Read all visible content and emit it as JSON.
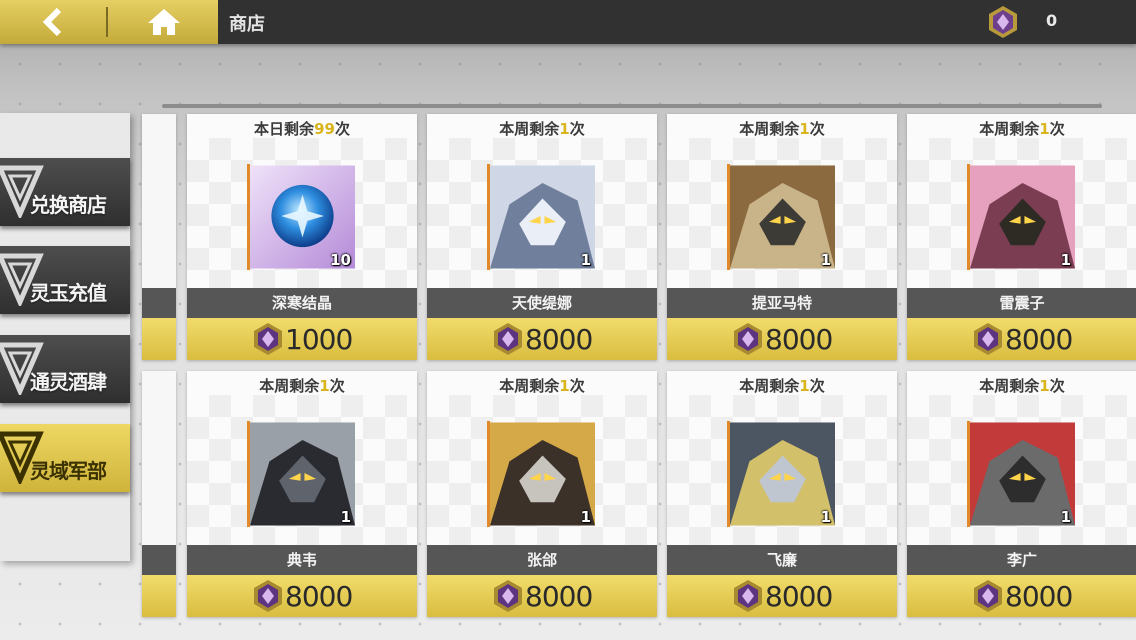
{
  "header": {
    "title": "商店",
    "currency_amount": "0",
    "back_icon": "back-arrow-icon",
    "home_icon": "home-icon",
    "currency_icon": "purple-gem-icon"
  },
  "colors": {
    "accent_gold": "#e3cb5a",
    "topbar": "#313131",
    "limit_highlight": "#d9b51b",
    "name_bar": "#565656"
  },
  "sidebar": {
    "tabs": [
      {
        "label": "兑换商店",
        "active": false
      },
      {
        "label": "灵玉充值",
        "active": false
      },
      {
        "label": "通灵酒肆",
        "active": false
      },
      {
        "label": "灵域军部",
        "active": true
      }
    ]
  },
  "shop": {
    "items": [
      {
        "limit_prefix": "本日剩余",
        "limit_num": "99",
        "limit_suffix": "次",
        "name": "深寒结晶",
        "qty": "10",
        "price": "1000",
        "icon": "ice-crystal-icon"
      },
      {
        "limit_prefix": "本周剩余",
        "limit_num": "1",
        "limit_suffix": "次",
        "name": "天使缇娜",
        "qty": "1",
        "price": "8000",
        "icon": "hero-portrait-icon"
      },
      {
        "limit_prefix": "本周剩余",
        "limit_num": "1",
        "limit_suffix": "次",
        "name": "提亚马特",
        "qty": "1",
        "price": "8000",
        "icon": "hero-portrait-icon"
      },
      {
        "limit_prefix": "本周剩余",
        "limit_num": "1",
        "limit_suffix": "次",
        "name": "雷震子",
        "qty": "1",
        "price": "8000",
        "icon": "hero-portrait-icon"
      },
      {
        "limit_prefix": "本周剩余",
        "limit_num": "1",
        "limit_suffix": "次",
        "name": "典韦",
        "qty": "1",
        "price": "8000",
        "icon": "hero-portrait-icon"
      },
      {
        "limit_prefix": "本周剩余",
        "limit_num": "1",
        "limit_suffix": "次",
        "name": "张郃",
        "qty": "1",
        "price": "8000",
        "icon": "hero-portrait-icon"
      },
      {
        "limit_prefix": "本周剩余",
        "limit_num": "1",
        "limit_suffix": "次",
        "name": "飞廉",
        "qty": "1",
        "price": "8000",
        "icon": "hero-portrait-icon"
      },
      {
        "limit_prefix": "本周剩余",
        "limit_num": "1",
        "limit_suffix": "次",
        "name": "李广",
        "qty": "1",
        "price": "8000",
        "icon": "hero-portrait-icon"
      }
    ]
  }
}
